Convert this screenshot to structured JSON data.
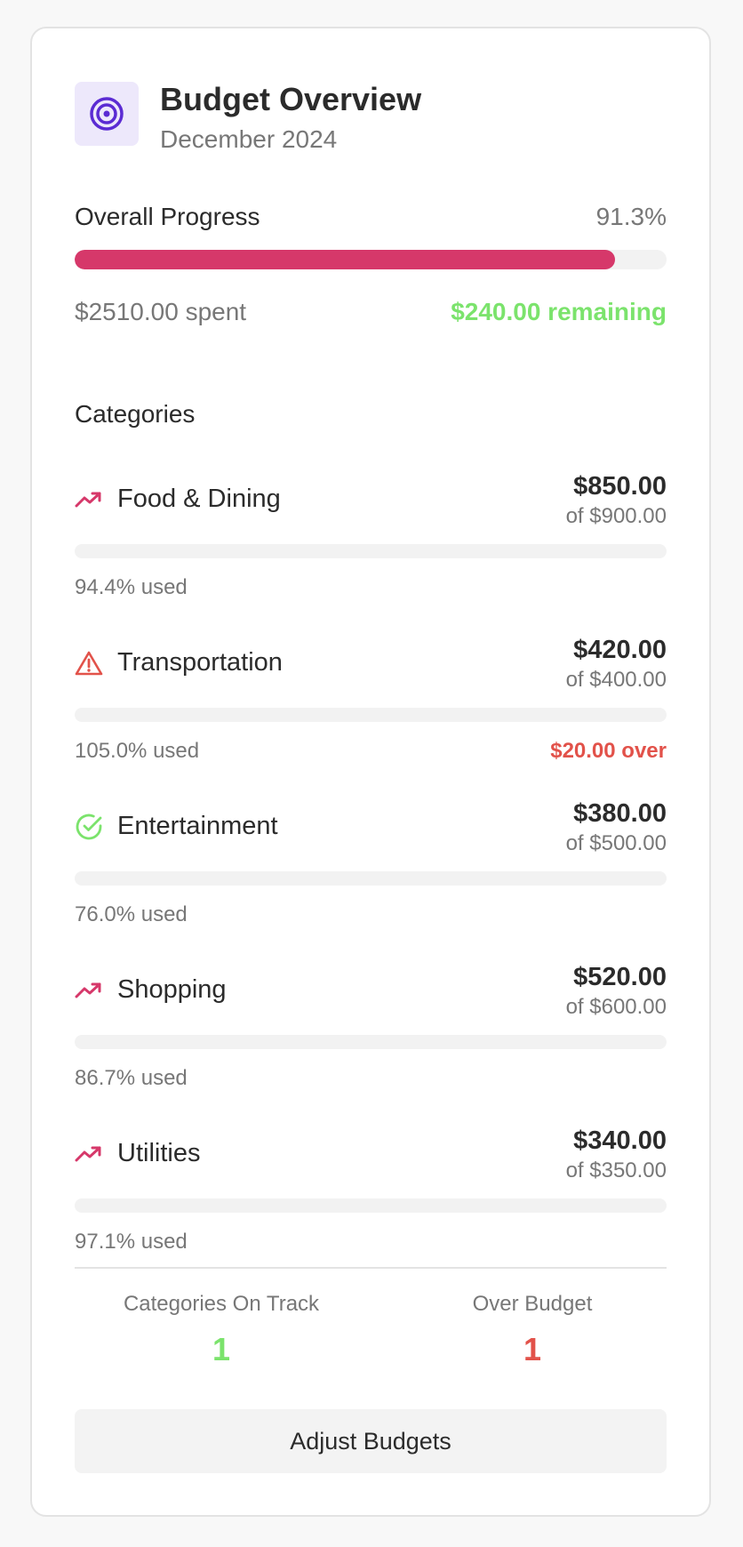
{
  "header": {
    "title": "Budget Overview",
    "subtitle": "December 2024",
    "icon": "target-icon",
    "icon_color": "#5b2bd3"
  },
  "overall": {
    "label": "Overall Progress",
    "percent_label": "91.3%",
    "progress": 0.913,
    "spent_label": "$2510.00 spent",
    "remaining_label": "$240.00 remaining",
    "bar_color": "#d6386a"
  },
  "categories_heading": "Categories",
  "categories": [
    {
      "name": "Food & Dining",
      "icon": "trending-up-icon",
      "amount": "$850.00",
      "of": "of $900.00",
      "used": "94.4% used",
      "over": "",
      "progress": 0.944,
      "bar_filled": false
    },
    {
      "name": "Transportation",
      "icon": "alert-triangle-icon",
      "amount": "$420.00",
      "of": "of $400.00",
      "used": "105.0% used",
      "over": "$20.00 over",
      "progress": 1.05,
      "bar_filled": false
    },
    {
      "name": "Entertainment",
      "icon": "check-circle-icon",
      "amount": "$380.00",
      "of": "of $500.00",
      "used": "76.0% used",
      "over": "",
      "progress": 0.76,
      "bar_filled": false
    },
    {
      "name": "Shopping",
      "icon": "trending-up-icon",
      "amount": "$520.00",
      "of": "of $600.00",
      "used": "86.7% used",
      "over": "",
      "progress": 0.867,
      "bar_filled": false
    },
    {
      "name": "Utilities",
      "icon": "trending-up-icon",
      "amount": "$340.00",
      "of": "of $350.00",
      "used": "97.1% used",
      "over": "",
      "progress": 0.971,
      "bar_filled": false
    }
  ],
  "stats": {
    "on_track_label": "Categories On Track",
    "on_track_value": "1",
    "over_label": "Over Budget",
    "over_value": "1"
  },
  "button_label": "Adjust Budgets",
  "colors": {
    "accent": "#d6386a",
    "success": "#7be36c",
    "danger": "#e2524a",
    "warning_icon": "#e2524a",
    "trend_icon": "#d6386a"
  }
}
